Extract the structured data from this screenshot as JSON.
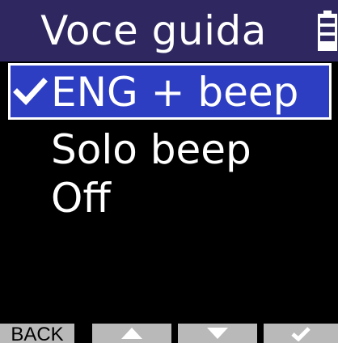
{
  "title_bar": {
    "title": "Voce guida",
    "battery_icon": "battery-full-icon"
  },
  "menu": {
    "items": [
      {
        "label": "ENG + beep",
        "selected": true,
        "checked": true
      },
      {
        "label": "Solo beep",
        "selected": false,
        "checked": false
      },
      {
        "label": "Off",
        "selected": false,
        "checked": false
      }
    ]
  },
  "soft_keys": {
    "back_label": "BACK",
    "up_icon": "up-arrow-icon",
    "down_icon": "down-arrow-icon",
    "confirm_icon": "checkmark-icon"
  },
  "colors": {
    "title_bar_bg": "#2f2860",
    "selection_bg": "#2d3ec3",
    "soft_key_bg": "#b9b9b9",
    "screen_bg": "#000000",
    "text": "#ffffff"
  }
}
